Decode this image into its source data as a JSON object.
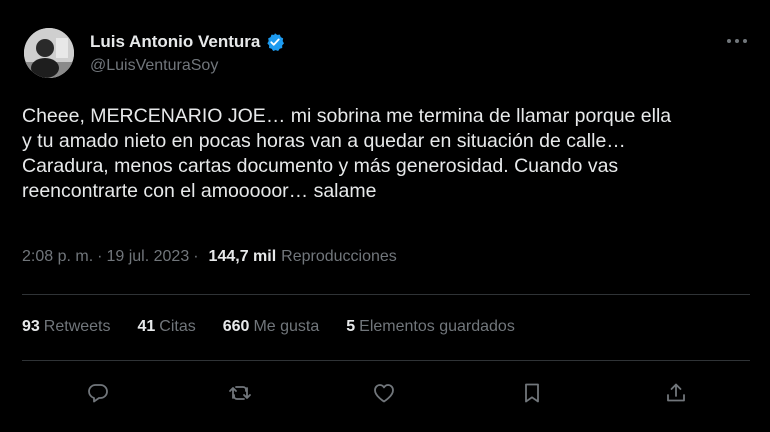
{
  "author": {
    "display_name": "Luis Antonio Ventura",
    "handle": "@LuisVenturaSoy",
    "verified": true,
    "avatar_icon": "avatar-photo"
  },
  "tweet": {
    "text": "Cheee, MERCENARIO JOE… mi sobrina me termina de llamar porque ella\ny tu amado nieto en pocas horas van a quedar en situación de calle…\nCaradura, menos cartas documento y más generosidad. Cuando vas\nreencontrarte con el amooooor… salame",
    "time": "2:08 p. m.",
    "separator": "·",
    "date": "19 jul. 2023",
    "views_count": "144,7 mil",
    "views_label": "Reproducciones"
  },
  "stats": {
    "retweets_count": "93",
    "retweets_label": "Retweets",
    "quotes_count": "41",
    "quotes_label": "Citas",
    "likes_count": "660",
    "likes_label": "Me gusta",
    "bookmarks_count": "5",
    "bookmarks_label": "Elementos guardados"
  },
  "actions": [
    "reply-icon",
    "retweet-icon",
    "like-icon",
    "bookmark-icon",
    "share-icon"
  ],
  "colors": {
    "background": "#000000",
    "text": "#e7e9ea",
    "secondary": "#71767b",
    "divider": "#2f3336",
    "verified": "#1d9bf0"
  }
}
